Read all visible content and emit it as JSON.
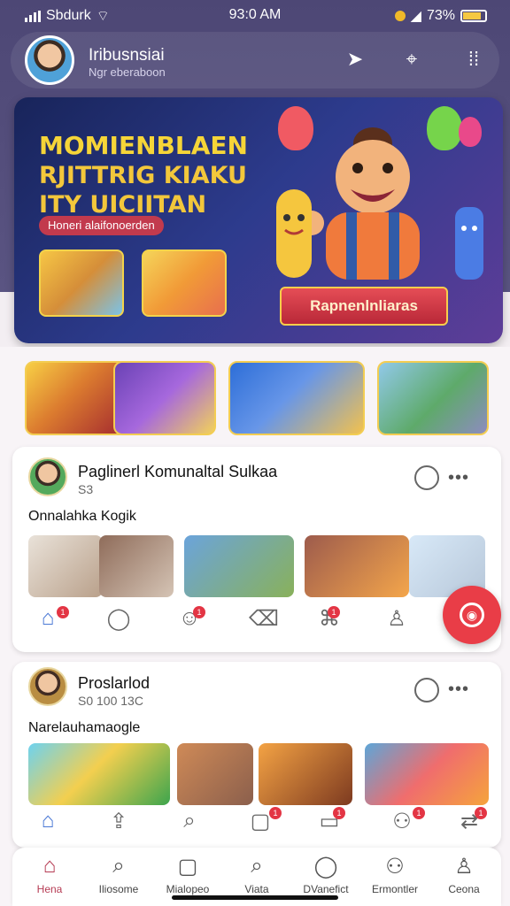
{
  "status": {
    "carrier": "Sbdurk",
    "time": "93:0 AM",
    "battery": "73%"
  },
  "header": {
    "name": "Iribusnsiai",
    "subtitle": "Ngr eberaboon",
    "icons": [
      "send-icon",
      "location-icon",
      "menu-grid-icon"
    ]
  },
  "banner": {
    "title_line1": "MOMIENBLAEN",
    "title_line2": "RJITTRIG KIAKU",
    "title_line3": "ITY UICIITAN",
    "tag": "Honeri alaifonoerden",
    "cta": "Rapnenlnliaras",
    "colors": {
      "accent": "#f6d538",
      "ribbon": "#c23a4d",
      "background": "#1b2865"
    }
  },
  "stories": [
    {
      "name": "story-person-red"
    },
    {
      "name": "story-kid-purple"
    },
    {
      "name": "story-friends-blue"
    },
    {
      "name": "story-park-green"
    }
  ],
  "posts": [
    {
      "name": "Paglinerl Komunaltal Sulkaa",
      "meta": "S3",
      "caption": "Onnalahka Kogik"
    },
    {
      "name": "Proslarlod",
      "meta": "S0 100 13C",
      "caption": "Narelauhamaogle"
    }
  ],
  "post_nav": {
    "items": [
      "home-icon",
      "chat-icon",
      "reaction-icon",
      "bin-icon",
      "tag-icon",
      "profile-icon"
    ],
    "badges": [
      "1",
      "1",
      "1"
    ]
  },
  "post2_nav": {
    "items": [
      "home-icon",
      "upload-icon",
      "search-icon",
      "message-icon",
      "inbox-icon",
      "group-icon",
      "connect-icon"
    ],
    "badges": [
      "1",
      "1",
      "1",
      "1"
    ]
  },
  "bottom_nav": {
    "items": [
      {
        "label": "Hena",
        "icon": "home-icon",
        "active": true
      },
      {
        "label": "Iliosome",
        "icon": "search-icon"
      },
      {
        "label": "Mialopeo",
        "icon": "message-icon"
      },
      {
        "label": "Viata",
        "icon": "search-icon"
      },
      {
        "label": "DVanefict",
        "icon": "chat-icon"
      },
      {
        "label": "Ermontler",
        "icon": "group-icon"
      },
      {
        "label": "Ceona",
        "icon": "profile-icon"
      }
    ]
  }
}
